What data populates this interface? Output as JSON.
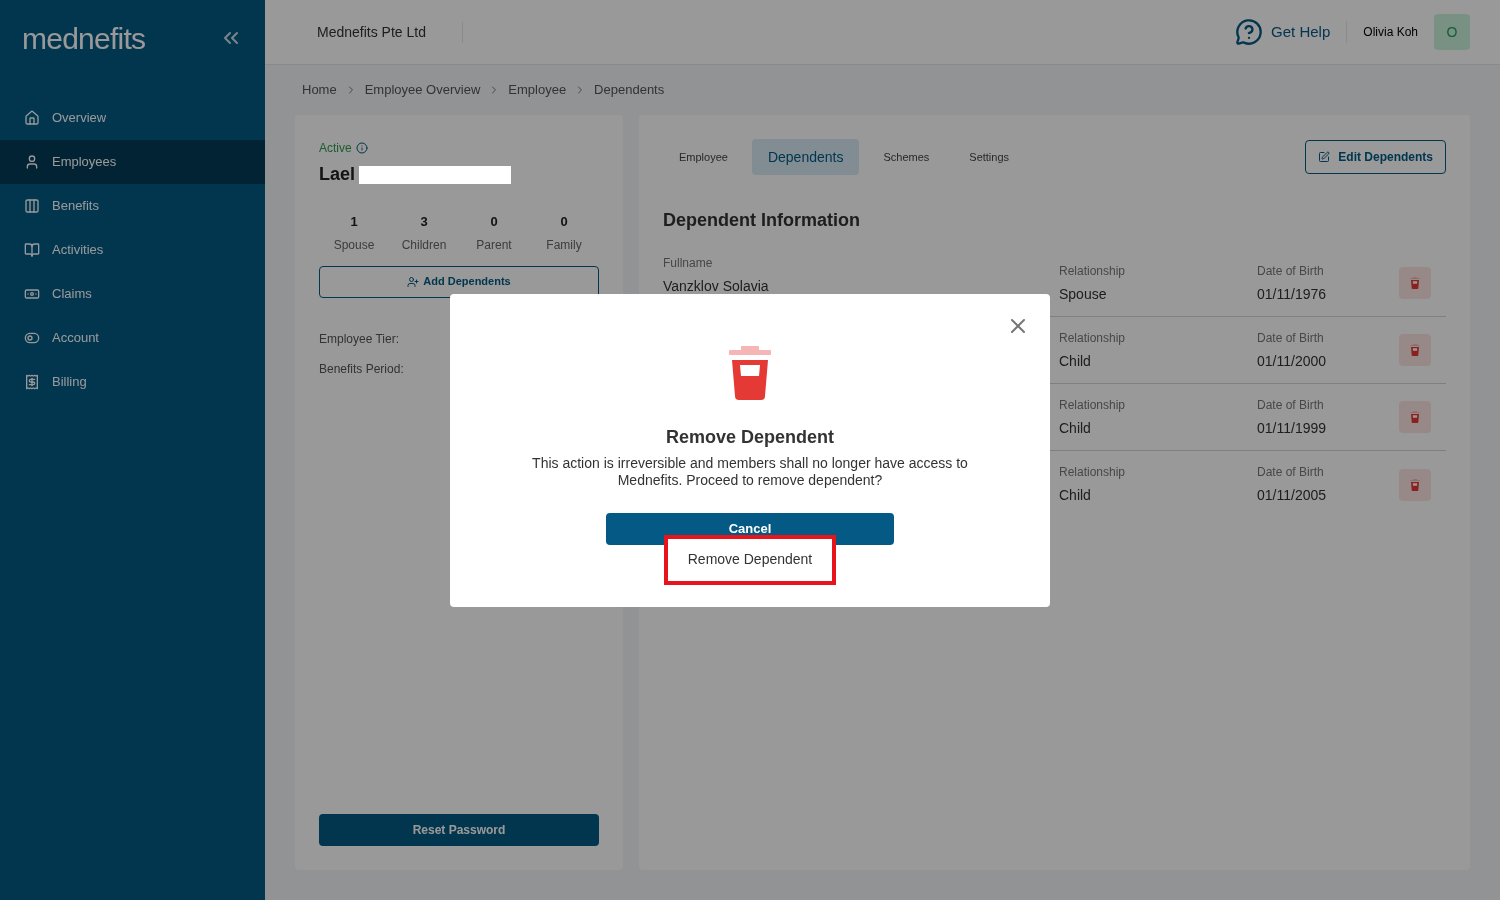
{
  "sidebar": {
    "logo": "mednefits",
    "items": [
      {
        "label": "Overview",
        "selected": false
      },
      {
        "label": "Employees",
        "selected": true
      },
      {
        "label": "Benefits",
        "selected": false
      },
      {
        "label": "Activities",
        "selected": false
      },
      {
        "label": "Claims",
        "selected": false
      },
      {
        "label": "Account",
        "selected": false
      },
      {
        "label": "Billing",
        "selected": false
      }
    ]
  },
  "header": {
    "company": "Mednefits Pte Ltd",
    "help": "Get Help",
    "user": "Olivia Koh",
    "avatar": "O"
  },
  "breadcrumb": [
    "Home",
    "Employee Overview",
    "Employee",
    "Dependents"
  ],
  "profile": {
    "status": "Active",
    "name": "Lael",
    "redacted": true,
    "counts": [
      {
        "value": "1",
        "label": "Spouse"
      },
      {
        "value": "3",
        "label": "Children"
      },
      {
        "value": "0",
        "label": "Parent"
      },
      {
        "value": "0",
        "label": "Family"
      }
    ],
    "add_button": "Add Dependents",
    "fields": [
      "Employee Tier:",
      "Benefits Period:"
    ],
    "reset_button": "Reset Password"
  },
  "tabs": [
    {
      "label": "Employee",
      "selected": false
    },
    {
      "label": "Dependents",
      "selected": true
    },
    {
      "label": "Schemes",
      "selected": false
    },
    {
      "label": "Settings",
      "selected": false
    }
  ],
  "edit_button": "Edit Dependents",
  "section_title": "Dependent Information",
  "dependents": [
    {
      "fullname_label": "Fullname",
      "fullname": "Vanzklov Solavia",
      "relationship_label": "Relationship",
      "relationship": "Spouse",
      "dob_label": "Date of Birth",
      "dob": "01/11/1976"
    },
    {
      "relationship_label": "Relationship",
      "relationship": "Child",
      "dob_label": "Date of Birth",
      "dob": "01/11/2000"
    },
    {
      "relationship_label": "Relationship",
      "relationship": "Child",
      "dob_label": "Date of Birth",
      "dob": "01/11/1999"
    },
    {
      "relationship_label": "Relationship",
      "relationship": "Child",
      "dob_label": "Date of Birth",
      "dob": "01/11/2005"
    }
  ],
  "modal": {
    "title": "Remove Dependent",
    "message": "This action is irreversible and members shall no longer have access to Mednefits. Proceed to remove dependent?",
    "cancel": "Cancel",
    "confirm": "Remove Dependent",
    "confirm_highlighted": true
  }
}
